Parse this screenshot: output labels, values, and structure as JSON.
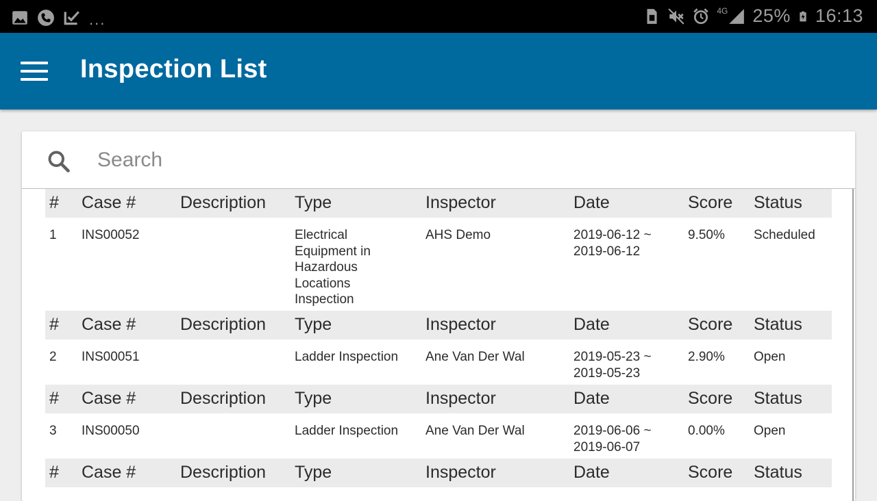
{
  "status_bar": {
    "dots": "...",
    "network": "4G",
    "battery": "25%",
    "time": "16:13"
  },
  "app_bar": {
    "title": "Inspection List"
  },
  "search": {
    "placeholder": "Search"
  },
  "columns": {
    "num": "#",
    "case": "Case #",
    "description": "Description",
    "type": "Type",
    "inspector": "Inspector",
    "date": "Date",
    "score": "Score",
    "status": "Status"
  },
  "rows": [
    {
      "num": "1",
      "case": "INS00052",
      "description": "",
      "type": "Electrical Equipment in Hazardous Locations Inspection",
      "inspector": "AHS Demo",
      "date": "2019-06-12 ~ 2019-06-12",
      "score": "9.50%",
      "status": "Scheduled"
    },
    {
      "num": "2",
      "case": "INS00051",
      "description": "",
      "type": "Ladder Inspection",
      "inspector": "Ane Van Der Wal",
      "date": "2019-05-23 ~ 2019-05-23",
      "score": "2.90%",
      "status": "Open"
    },
    {
      "num": "3",
      "case": "INS00050",
      "description": "",
      "type": "Ladder Inspection",
      "inspector": "Ane Van Der Wal",
      "date": "2019-06-06 ~ 2019-06-07",
      "score": "0.00%",
      "status": "Open"
    }
  ]
}
